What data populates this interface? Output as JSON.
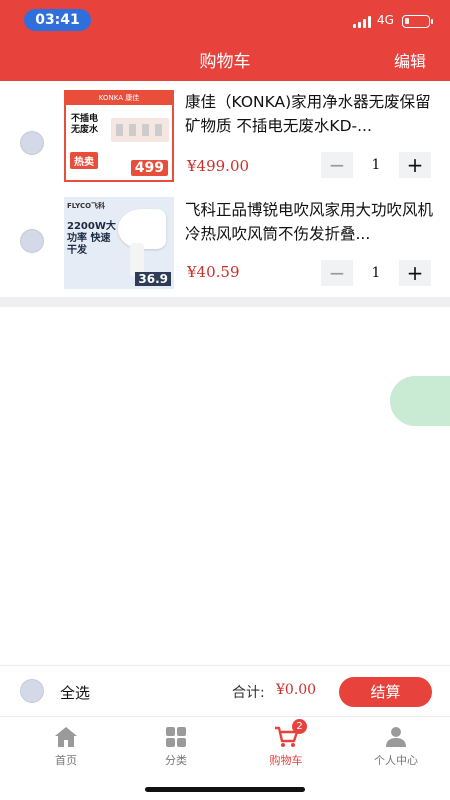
{
  "status_bar": {
    "time": "03:41",
    "network": "4G"
  },
  "header": {
    "title": "购物车",
    "edit_label": "编辑"
  },
  "cart": {
    "items": [
      {
        "name": "康佳（KONKA)家用净水器无废保留矿物质 不插电无废水KD-...",
        "price": "¥499.00",
        "quantity": "1",
        "thumb": {
          "brand": "KONKA 康佳",
          "slogan": "不插电 无废水",
          "hot_label": "热卖",
          "price_tag": "499"
        }
      },
      {
        "name": "飞科正品博锐电吹风家用大功吹风机冷热风吹风筒不伤发折叠...",
        "price": "¥40.59",
        "quantity": "1",
        "thumb": {
          "brand": "FLYCO飞科",
          "headline": "2200W大功率 快速干发",
          "price_tag": "36.9"
        }
      }
    ]
  },
  "checkout": {
    "select_all_label": "全选",
    "total_label": "合计:",
    "total_value": "¥0.00",
    "pay_label": "结算"
  },
  "tabbar": {
    "tabs": [
      {
        "label": "首页",
        "icon": "home-icon"
      },
      {
        "label": "分类",
        "icon": "category-icon"
      },
      {
        "label": "购物车",
        "icon": "cart-icon",
        "badge": "2"
      },
      {
        "label": "个人中心",
        "icon": "user-icon"
      }
    ]
  },
  "colors": {
    "brand": "#e8423d",
    "price": "#c9302c",
    "float_ball": "#c9ead3"
  }
}
